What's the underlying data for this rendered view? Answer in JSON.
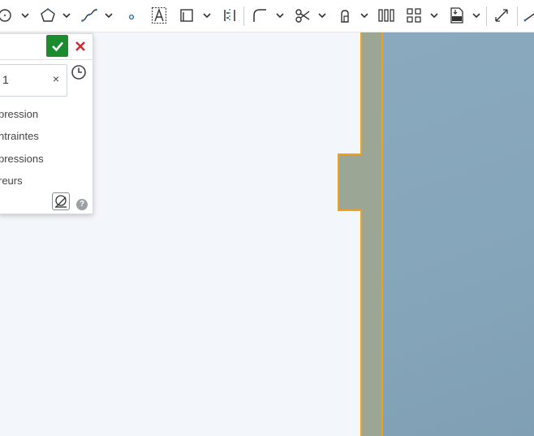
{
  "toolbar": {
    "tools": [
      {
        "icon": "circle-icon"
      },
      {
        "icon": "polygon-icon"
      },
      {
        "icon": "spline-icon"
      },
      {
        "icon": "point-icon"
      },
      {
        "icon": "text-icon"
      },
      {
        "icon": "offset-icon"
      },
      {
        "icon": "mirror-icon"
      },
      {
        "icon": "fillet-icon"
      },
      {
        "icon": "trim-icon"
      },
      {
        "icon": "transform-icon"
      },
      {
        "icon": "linear-pattern-icon"
      },
      {
        "icon": "grid-pattern-icon"
      },
      {
        "icon": "dxf-import-icon"
      },
      {
        "icon": "dimension-icon"
      },
      {
        "icon": "line-icon"
      }
    ]
  },
  "dialog": {
    "field_value": "1",
    "field_clear": "×",
    "options": [
      "pression",
      "ntraintes",
      "pressions",
      "reurs"
    ],
    "help": "?"
  },
  "colors": {
    "accent_ok": "#1c8a2e",
    "cancel": "#d0282e",
    "selection": "#f0a01e",
    "part_face": "#86a6bb",
    "part_strip": "#9ba794"
  }
}
